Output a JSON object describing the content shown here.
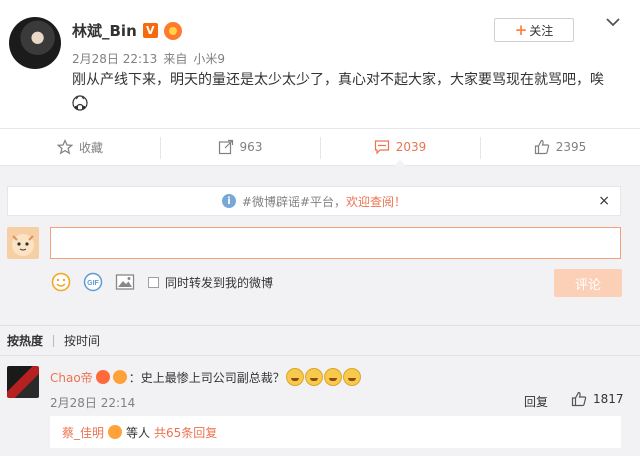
{
  "post": {
    "author": "林斌_Bin",
    "verified_badge": "V",
    "date": "2月28日 22:13",
    "source_prefix": "来自",
    "source": "小米9",
    "text": "刚从产线下来，明天的量还是太少太少了，真心对不起大家，大家要骂现在就骂吧，唉",
    "follow_label": "关注",
    "follow_plus": "+",
    "menu_icon": "chevron-down-icon"
  },
  "actions": {
    "favorite": {
      "label": "收藏",
      "icon": "star-icon"
    },
    "repost": {
      "count": "963",
      "icon": "repost-icon"
    },
    "comment": {
      "count": "2039",
      "icon": "comment-icon",
      "active": true
    },
    "like": {
      "count": "2395",
      "icon": "thumbs-up-icon"
    }
  },
  "comment_box": {
    "notice_prefix": "#微博辟谣#平台，",
    "notice_link": "欢迎查阅！",
    "notice_close": "×",
    "input_value": "",
    "repost_label": "同时转发到我的微博",
    "submit_label": "评论",
    "tools": [
      "emoji-icon",
      "gif-icon",
      "image-icon"
    ]
  },
  "sort": {
    "hot": "按热度",
    "time": "按时间"
  },
  "comments": [
    {
      "user": "Chao帝",
      "text": "：史上最惨上司公司副总裁？",
      "emoji_count": 4,
      "time": "2月28日 22:14",
      "reply_label": "回复",
      "likes": "1817",
      "sub_reply": {
        "name": "蔡_佳明",
        "text": "等人",
        "count": "共65条回复"
      }
    }
  ],
  "colors": {
    "accent": "#eb7350",
    "panel_bg": "#f2f2f5",
    "submit_disabled": "#fbd0b7"
  }
}
